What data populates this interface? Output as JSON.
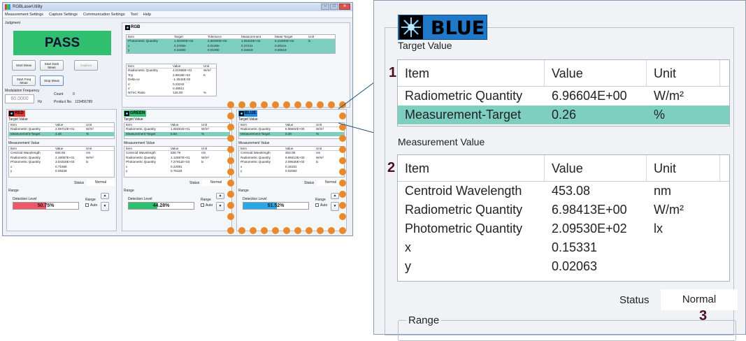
{
  "window": {
    "title": "RGBLaserUtility",
    "min": "‒",
    "max": "□",
    "close": "✕"
  },
  "menu": [
    "Measurement Settings",
    "Capture Settings",
    "Communication Settings",
    "Tool",
    "Help"
  ],
  "judgment": {
    "label": "Judgment",
    "result": "PASS"
  },
  "buttons": {
    "start_meas": "Start Meas",
    "start_dark": "Start Dark Meas",
    "capture": "Capture",
    "start_freq": "Start Freq Meas",
    "stop_meas": "Stop Meas"
  },
  "modulation": {
    "label": "Modulation Frequency",
    "value": "60.0000",
    "unit": "Hz",
    "count_label": "Count",
    "count": "0",
    "product_label": "Product No.",
    "product": "123456789"
  },
  "rgb": {
    "title": "RGB",
    "top_headers": [
      "Item",
      "Target",
      "Tolerance",
      "Measurement",
      "Meas-Target",
      "Unit"
    ],
    "top_rows": [
      [
        "Photometric Quantity",
        "1.00000E+04",
        "2.00000E+03",
        "1.05316E+04",
        "5.31600E+02",
        "lx"
      ],
      [
        "x",
        "0.37000",
        "0.01000",
        "0.37241",
        "0.00241",
        ""
      ],
      [
        "y",
        "0.34000",
        "0.01000",
        "0.34619",
        "0.00619",
        ""
      ]
    ],
    "bottom_headers": [
      "Item",
      "Value",
      "Unit"
    ],
    "bottom_rows": [
      [
        "Radiometric Quantity",
        "4.01595E+01",
        "W/m²"
      ],
      [
        "Tcp",
        "3.9915E+03",
        "K"
      ],
      [
        "Delta uv",
        "-1.2642E-02",
        ""
      ],
      [
        "u'",
        "0.23242",
        ""
      ],
      [
        "v'",
        "0.48611",
        ""
      ],
      [
        "NTSC Ratio",
        "126.00",
        "%"
      ]
    ]
  },
  "channels": [
    {
      "name": "RED",
      "color": "#e53935",
      "target_label": "Target Value",
      "target_rows": [
        [
          "Radiometric Quantity",
          "2.09714E+01",
          "W/m²"
        ],
        [
          "Measurement-Target",
          "4.46",
          "%"
        ]
      ],
      "meas_label": "Measurement Value",
      "meas_rows": [
        [
          "Centroid Wavelength",
          "636.55",
          "nm"
        ],
        [
          "Radiometric Quantity",
          "2.19057E+01",
          "W/m²"
        ],
        [
          "Photometric Quantity",
          "3.04318E+03",
          "lx"
        ],
        [
          "x",
          "0.71568",
          ""
        ],
        [
          "y",
          "0.28428",
          ""
        ]
      ],
      "status_label": "Status",
      "status": "Normal",
      "range_label": "Range",
      "detect_label": "Detection Level",
      "detect": "50.75%",
      "detect_fraction": 0.5075,
      "bar_color": "#f0566a",
      "range_btn": "Range",
      "auto": "Auto"
    },
    {
      "name": "GREEN",
      "color": "#2bbf6e",
      "target_label": "Target Value",
      "target_rows": [
        [
          "Radiometric Quantity",
          "1.06481E+01",
          "W/m²"
        ],
        [
          "Measurement-Target",
          "5.84",
          "%"
        ]
      ],
      "meas_label": "Measurement Value",
      "meas_rows": [
        [
          "Centroid Wavelength",
          "538.79",
          "nm"
        ],
        [
          "Radiometric Quantity",
          "1.12697E+01",
          "W/m²"
        ],
        [
          "Photometric Quantity",
          "7.27911E+03",
          "lx"
        ],
        [
          "x",
          "0.22081",
          ""
        ],
        [
          "y",
          "0.76118",
          ""
        ]
      ],
      "status_label": "Status",
      "status": "Normal",
      "range_label": "Range",
      "detect_label": "Detection Level",
      "detect": "44.28%",
      "detect_fraction": 0.4428,
      "bar_color": "#2bbf6e",
      "range_btn": "Range",
      "auto": "Auto"
    },
    {
      "name": "BLUE",
      "color": "#1e88e5",
      "target_label": "Target Value",
      "target_rows": [
        [
          "Radiometric Quantity",
          "6.96604E+00",
          "W/m²"
        ],
        [
          "Measurement-Target",
          "0.26",
          "%"
        ]
      ],
      "meas_label": "Measurement Value",
      "meas_rows": [
        [
          "Centroid Wavelength",
          "453.08",
          "nm"
        ],
        [
          "Radiometric Quantity",
          "6.98413E+00",
          "W/m²"
        ],
        [
          "Photometric Quantity",
          "2.09530E+02",
          "lx"
        ],
        [
          "x",
          "0.15331",
          ""
        ],
        [
          "y",
          "0.02063",
          ""
        ]
      ],
      "status_label": "Status",
      "status": "Normal",
      "range_label": "Range",
      "detect_label": "Detection Level",
      "detect": "51.52%",
      "detect_fraction": 0.5152,
      "bar_color": "#29a8e8",
      "range_btn": "Range",
      "auto": "Auto"
    }
  ],
  "table_headers": [
    "Item",
    "Value",
    "Unit"
  ],
  "zoom": {
    "title": "BLUE",
    "target_label": "Target Value",
    "headers": [
      "Item",
      "Value",
      "Unit"
    ],
    "target_rows": [
      [
        "Radiometric Quantity",
        "6.96604E+00",
        "W/m²"
      ],
      [
        "Measurement-Target",
        "0.26",
        "%"
      ]
    ],
    "meas_label": "Measurement Value",
    "meas_rows": [
      [
        "Centroid Wavelength",
        "453.08",
        "nm"
      ],
      [
        "Radiometric Quantity",
        "6.98413E+00",
        "W/m²"
      ],
      [
        "Photometric Quantity",
        "2.09530E+02",
        "lx"
      ],
      [
        "x",
        "0.15331",
        ""
      ],
      [
        "y",
        "0.02063",
        ""
      ]
    ],
    "status_label": "Status",
    "status": "Normal",
    "range_label": "Range",
    "callouts": [
      "1",
      "2",
      "3"
    ]
  }
}
